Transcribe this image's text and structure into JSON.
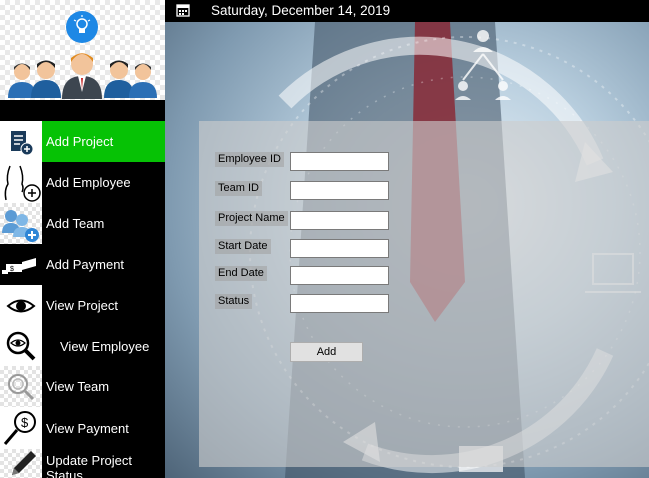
{
  "topbar": {
    "date": "Saturday, December 14, 2019"
  },
  "sidebar": {
    "items": [
      {
        "label": "Add Project",
        "icon": "document-add-icon",
        "active": true
      },
      {
        "label": "Add Employee",
        "icon": "person-add-icon"
      },
      {
        "label": "Add Team",
        "icon": "team-add-icon"
      },
      {
        "label": "Add Payment",
        "icon": "money-icon"
      },
      {
        "label": "View Project",
        "icon": "eye-icon"
      },
      {
        "label": "View Employee",
        "icon": "eye-magnifier-icon"
      },
      {
        "label": "View Team",
        "icon": "magnifier-icon"
      },
      {
        "label": "View Payment",
        "icon": "payment-search-icon"
      },
      {
        "label": "Update Project Status",
        "icon": "pencil-icon"
      }
    ]
  },
  "form": {
    "fields": [
      {
        "label": "Employee ID",
        "value": ""
      },
      {
        "label": "Team ID",
        "value": ""
      },
      {
        "label": "Project Name",
        "value": ""
      },
      {
        "label": "Start Date",
        "value": ""
      },
      {
        "label": "End Date",
        "value": ""
      },
      {
        "label": "Status",
        "value": ""
      }
    ],
    "submit_label": "Add"
  },
  "colors": {
    "sidebar_bg": "#000000",
    "active_item": "#06c205",
    "panel": "#cdcdcd"
  }
}
